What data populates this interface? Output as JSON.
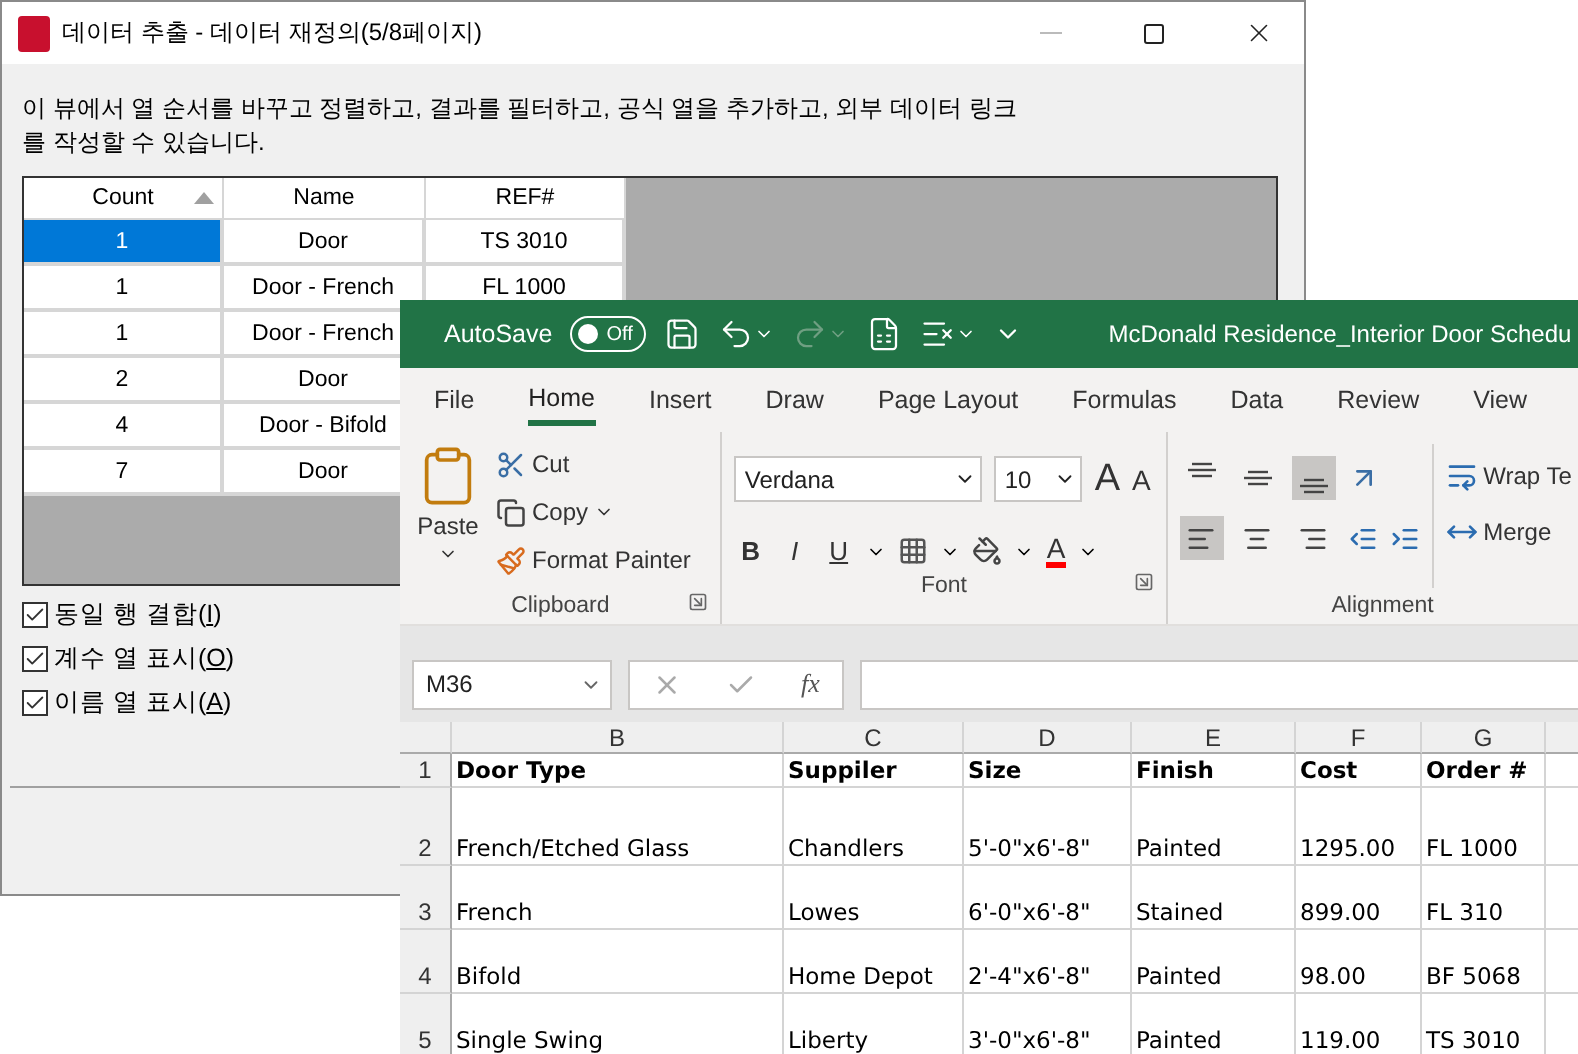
{
  "dialog": {
    "title": "데이터 추출 - 데이터 재정의(5/8페이지)",
    "description": "이 뷰에서 열 순서를 바꾸고 정렬하고, 결과를 필터하고, 공식 열을 추가하고, 외부 데이터 링크를 작성할 수 있습니다.",
    "table": {
      "columns": [
        {
          "label": "Count",
          "sorted": true
        },
        {
          "label": "Name",
          "sorted": false
        },
        {
          "label": "REF#",
          "sorted": false
        }
      ],
      "rows": [
        {
          "selected": true,
          "cells": [
            "1",
            "Door",
            "TS 3010"
          ]
        },
        {
          "selected": false,
          "cells": [
            "1",
            "Door - French",
            "FL 1000"
          ]
        },
        {
          "selected": false,
          "cells": [
            "1",
            "Door - French"
          ]
        },
        {
          "selected": false,
          "cells": [
            "2",
            "Door"
          ]
        },
        {
          "selected": false,
          "cells": [
            "4",
            "Door - Bifold"
          ]
        },
        {
          "selected": false,
          "cells": [
            "7",
            "Door"
          ]
        }
      ]
    },
    "options": [
      {
        "before": "동일 행 결합(",
        "key": "I",
        "after": ")",
        "checked": true
      },
      {
        "before": "계수 열 표시(",
        "key": "O",
        "after": ")",
        "checked": true
      },
      {
        "before": "이름 열 표시(",
        "key": "A",
        "after": ")",
        "checked": true
      }
    ]
  },
  "excel": {
    "autosave": {
      "label": "AutoSave",
      "state": "Off",
      "on": false
    },
    "redo_disabled": true,
    "title": "McDonald Residence_Interior Door Schedu",
    "tabs": [
      {
        "label": "File",
        "selected": false
      },
      {
        "label": "Home",
        "selected": true
      },
      {
        "label": "Insert",
        "selected": false
      },
      {
        "label": "Draw",
        "selected": false
      },
      {
        "label": "Page Layout",
        "selected": false
      },
      {
        "label": "Formulas",
        "selected": false
      },
      {
        "label": "Data",
        "selected": false
      },
      {
        "label": "Review",
        "selected": false
      },
      {
        "label": "View",
        "selected": false
      }
    ],
    "clipboard": {
      "paste": "Paste",
      "cut": "Cut",
      "copy": "Copy",
      "format_painter": "Format Painter",
      "group": "Clipboard"
    },
    "font": {
      "name": "Verdana",
      "size": "10",
      "grow": "A",
      "shrink": "A",
      "styles": [
        "B",
        "I",
        "U"
      ],
      "color_letter": "A",
      "group": "Font"
    },
    "alignment": {
      "vertical": [
        {
          "selected": false
        },
        {
          "selected": false
        },
        {
          "selected": true
        }
      ],
      "horizontal": [
        {
          "selected": true
        },
        {
          "selected": false
        },
        {
          "selected": false
        }
      ],
      "wrap": "Wrap Te",
      "merge": "Merge",
      "group": "Alignment"
    },
    "name_box": "M36",
    "fx": "fx",
    "sheet": {
      "columns": [
        "B",
        "C",
        "D",
        "E",
        "F",
        "G"
      ],
      "rows": [
        {
          "number": "1",
          "kind": "header",
          "cells": [
            "Door Type",
            "Suppiler",
            "Size",
            "Finish",
            "Cost",
            "Order #"
          ]
        },
        {
          "number": "2",
          "kind": "tall",
          "cells": [
            "French/Etched Glass",
            "Chandlers",
            "5'-0\"x6'-8\"",
            "Painted",
            "1295.00",
            "FL 1000"
          ]
        },
        {
          "number": "3",
          "kind": "data",
          "cells": [
            "French",
            "Lowes",
            "6'-0\"x6'-8\"",
            "Stained",
            "899.00",
            "FL 310"
          ]
        },
        {
          "number": "4",
          "kind": "data",
          "cells": [
            "Bifold",
            "Home Depot",
            "2'-4\"x6'-8\"",
            "Painted",
            "98.00",
            "BF 5068"
          ]
        },
        {
          "number": "5",
          "kind": "data",
          "cells": [
            "Single Swing",
            "Liberty",
            "3'-0\"x6'-8\"",
            "Painted",
            "119.00",
            "TS 3010"
          ]
        }
      ]
    }
  }
}
